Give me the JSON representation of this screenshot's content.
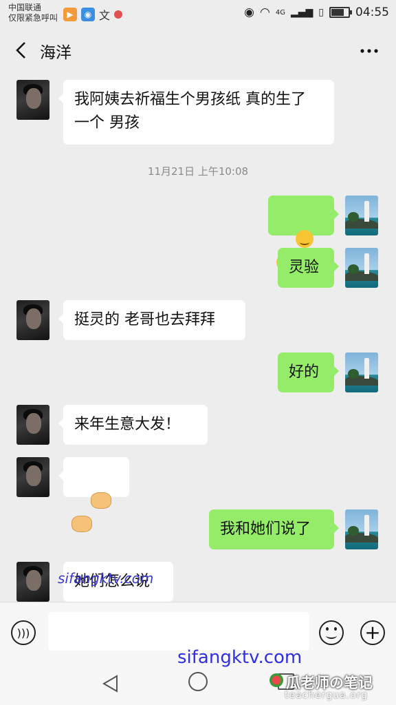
{
  "status_bar": {
    "carrier_line1": "中国联通",
    "carrier_line2": "仅限紧急呼叫",
    "network": "4G",
    "time": "04:55"
  },
  "header": {
    "title": "海洋",
    "back_icon": "chevron-left-icon",
    "more_icon": "ellipsis-icon"
  },
  "messages": [
    {
      "side": "in",
      "text": "我阿姨去祈福生个男孩纸 真的生了\n一个 男孩"
    },
    {
      "type": "time",
      "text": "11月21日 上午10:08"
    },
    {
      "side": "out",
      "emoji": "grinning-hand-emoji",
      "count": 2
    },
    {
      "side": "out",
      "text": "灵验"
    },
    {
      "side": "in",
      "text": "挺灵的 老哥也去拜拜"
    },
    {
      "side": "out",
      "text": "好的"
    },
    {
      "side": "in",
      "text": "来年生意大发！"
    },
    {
      "side": "in",
      "emoji": "handshake-emoji",
      "count": 2
    },
    {
      "side": "out",
      "text": "我和她们说了"
    },
    {
      "side": "in",
      "text": "她们怎么说"
    }
  ],
  "watermarks": {
    "overlay_small": "sifangktv.com",
    "overlay_big": "sifangktv.com",
    "teacher": "瓜老师の笔记",
    "teacher_site": "teachergua.org"
  },
  "colors": {
    "background": "#ededed",
    "bubble_out": "#95ec69",
    "bubble_in": "#ffffff"
  }
}
